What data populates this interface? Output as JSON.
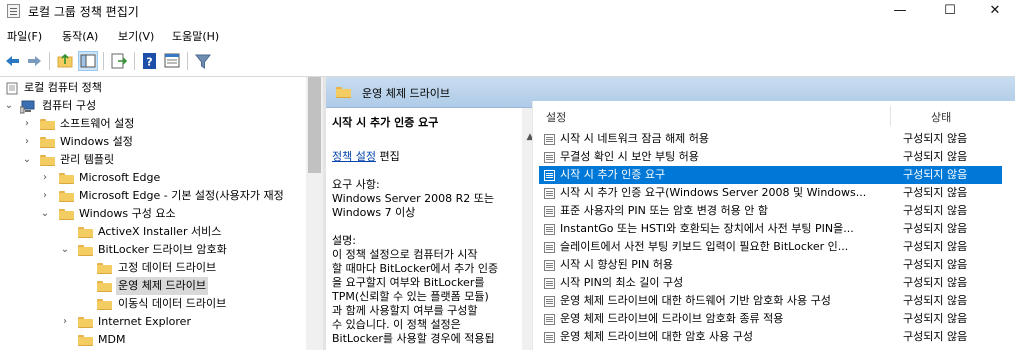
{
  "window": {
    "title": "로컬 그룹 정책 편집기",
    "minimize": "—",
    "maximize": "☐",
    "close": "✕"
  },
  "menu": [
    "파일(F)",
    "동작(A)",
    "보기(V)",
    "도움말(H)"
  ],
  "toolbar": [
    "back-icon",
    "forward-icon",
    "up-folder-icon",
    "show-hide-tree-icon",
    "export-list-icon",
    "help-icon",
    "properties-icon",
    "filter-icon"
  ],
  "tree": {
    "items": [
      {
        "label": "로컬 컴퓨터 정책"
      },
      {
        "label": "컴퓨터 구성"
      },
      {
        "label": "소프트웨어 설정"
      },
      {
        "label": "Windows 설정"
      },
      {
        "label": "관리 템플릿"
      },
      {
        "label": "Microsoft Edge"
      },
      {
        "label": "Microsoft Edge - 기본 설정(사용자가 재정"
      },
      {
        "label": "Windows 구성 요소"
      },
      {
        "label": "ActiveX Installer 서비스"
      },
      {
        "label": "BitLocker 드라이브 암호화"
      },
      {
        "label": "고정 데이터 드라이브"
      },
      {
        "label": "운영 체제 드라이브"
      },
      {
        "label": "이동식 데이터 드라이브"
      },
      {
        "label": "Internet Explorer"
      },
      {
        "label": "MDM"
      }
    ]
  },
  "right": {
    "header_title": "운영 체제 드라이브",
    "description": {
      "title": "시작 시 추가 인증 요구",
      "edit_link": "정책 설정",
      "edit_suffix": "편집",
      "req_label": "요구 사항:",
      "req_1": "Windows Server 2008 R2 또는",
      "req_2": "Windows 7 이상",
      "desc_label": "설명:",
      "desc_1": "이 정책 설정으로 컴퓨터가 시작",
      "desc_2": "할 때마다 BitLocker에서 추가 인증",
      "desc_3": "을 요구할지 여부와 BitLocker를",
      "desc_4": "TPM(신뢰할 수 있는 플랫폼 모듈)",
      "desc_5": "과 함께 사용할지 여부를 구성할",
      "desc_6": "수 있습니다. 이 정책 설정은",
      "desc_7": "BitLocker를 사용할 경우에 적용됩"
    },
    "list": {
      "col_setting": "설정",
      "col_state": "상태",
      "rows": [
        {
          "name": "시작 시 네트워크 잠금 해제 허용",
          "state": "구성되지 않음"
        },
        {
          "name": "무결성 확인 시 보안 부팅 허용",
          "state": "구성되지 않음"
        },
        {
          "name": "시작 시 추가 인증 요구",
          "state": "구성되지 않음"
        },
        {
          "name": "시작 시 추가 인증 요구(Windows Server 2008 및 Windows...",
          "state": "구성되지 않음"
        },
        {
          "name": "표준 사용자의 PIN 또는 암호 변경 허용 안 함",
          "state": "구성되지 않음"
        },
        {
          "name": "InstantGo 또는 HSTI와 호환되는 장치에서 사전 부팅 PIN을...",
          "state": "구성되지 않음"
        },
        {
          "name": "슬레이트에서 사전 부팅 키보드 입력이 필요한 BitLocker 인...",
          "state": "구성되지 않음"
        },
        {
          "name": "시작 시 향상된 PIN 허용",
          "state": "구성되지 않음"
        },
        {
          "name": "시작 PIN의 최소 길이 구성",
          "state": "구성되지 않음"
        },
        {
          "name": "운영 체제 드라이브에 대한 하드웨어 기반 암호화 사용 구성",
          "state": "구성되지 않음"
        },
        {
          "name": "운영 체제 드라이브에 드라이브 암호화 종류 적용",
          "state": "구성되지 않음"
        },
        {
          "name": "운영 체제 드라이브에 대한 암호 사용 구성",
          "state": "구성되지 않음"
        }
      ]
    }
  }
}
